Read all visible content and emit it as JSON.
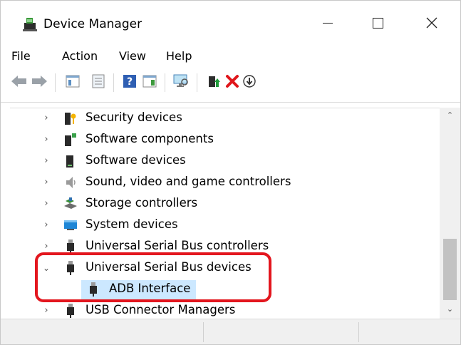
{
  "window": {
    "title": "Device Manager",
    "app_icon": "device-manager-icon"
  },
  "window_controls": {
    "minimize_icon": "minimize-icon",
    "maximize_icon": "maximize-icon",
    "close_icon": "close-icon"
  },
  "menu": [
    "File",
    "Action",
    "View",
    "Help"
  ],
  "toolbar": [
    "back-arrow-icon",
    "forward-arrow-icon",
    "show-hide-tree-icon",
    "properties-icon",
    "help-icon",
    "action-pane-icon",
    "scan-hardware-icon",
    "update-driver-icon",
    "uninstall-icon",
    "disable-device-icon"
  ],
  "tree": {
    "rows": [
      {
        "label": "Security devices",
        "icon": "security-device-icon",
        "expanded": false
      },
      {
        "label": "Software components",
        "icon": "software-component-icon",
        "expanded": false
      },
      {
        "label": "Software devices",
        "icon": "software-device-icon",
        "expanded": false
      },
      {
        "label": "Sound, video and game controllers",
        "icon": "speaker-icon",
        "expanded": false
      },
      {
        "label": "Storage controllers",
        "icon": "storage-controller-icon",
        "expanded": false
      },
      {
        "label": "System devices",
        "icon": "system-devices-icon",
        "expanded": false
      },
      {
        "label": "Universal Serial Bus controllers",
        "icon": "usb-plug-icon",
        "expanded": false
      },
      {
        "label": "Universal Serial Bus devices",
        "icon": "usb-plug-icon",
        "expanded": true
      },
      {
        "label": "ADB Interface",
        "icon": "usb-plug-icon",
        "child": true,
        "selected": true
      },
      {
        "label": "USB Connector Managers",
        "icon": "usb-plug-icon",
        "expanded": false
      }
    ]
  },
  "colors": {
    "highlight": "#e3161e",
    "selection": "#cce8ff"
  }
}
